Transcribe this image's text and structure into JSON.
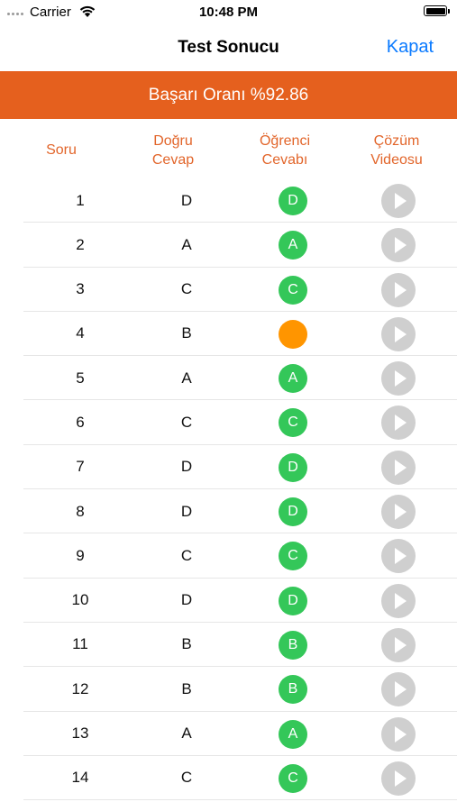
{
  "status_bar": {
    "carrier": "Carrier",
    "time": "10:48 PM"
  },
  "nav": {
    "title": "Test Sonucu",
    "close_label": "Kapat"
  },
  "banner": {
    "text": "Başarı Oranı %92.86"
  },
  "table": {
    "headers": {
      "question": "Soru",
      "correct_line1": "Doğru",
      "correct_line2": "Cevap",
      "student_line1": "Öğrenci",
      "student_line2": "Cevabı",
      "video_line1": "Çözüm",
      "video_line2": "Videosu"
    },
    "colors": {
      "correct": "#34c759",
      "empty": "#ff9500",
      "video_button": "#cfcfcf",
      "accent": "#e5601e"
    },
    "rows": [
      {
        "no": "1",
        "correct": "D",
        "student": "D",
        "status": "correct"
      },
      {
        "no": "2",
        "correct": "A",
        "student": "A",
        "status": "correct"
      },
      {
        "no": "3",
        "correct": "C",
        "student": "C",
        "status": "correct"
      },
      {
        "no": "4",
        "correct": "B",
        "student": "",
        "status": "empty"
      },
      {
        "no": "5",
        "correct": "A",
        "student": "A",
        "status": "correct"
      },
      {
        "no": "6",
        "correct": "C",
        "student": "C",
        "status": "correct"
      },
      {
        "no": "7",
        "correct": "D",
        "student": "D",
        "status": "correct"
      },
      {
        "no": "8",
        "correct": "D",
        "student": "D",
        "status": "correct"
      },
      {
        "no": "9",
        "correct": "C",
        "student": "C",
        "status": "correct"
      },
      {
        "no": "10",
        "correct": "D",
        "student": "D",
        "status": "correct"
      },
      {
        "no": "11",
        "correct": "B",
        "student": "B",
        "status": "correct"
      },
      {
        "no": "12",
        "correct": "B",
        "student": "B",
        "status": "correct"
      },
      {
        "no": "13",
        "correct": "A",
        "student": "A",
        "status": "correct"
      },
      {
        "no": "14",
        "correct": "C",
        "student": "C",
        "status": "correct"
      }
    ]
  }
}
